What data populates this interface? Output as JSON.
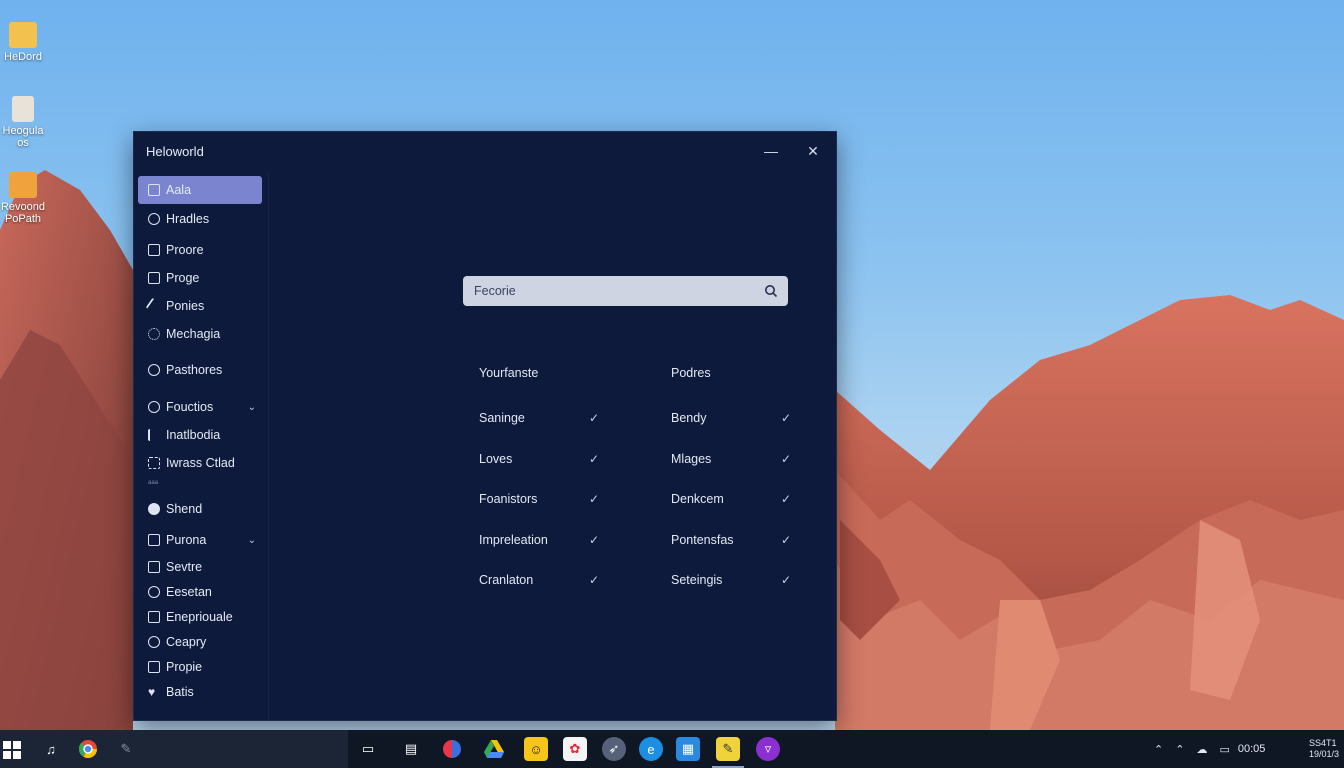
{
  "desktop": {
    "icons": [
      {
        "label": "HeDord",
        "icon": "folder-icon",
        "color": "#f2c14e"
      },
      {
        "label": "Heogula",
        "sublabel": "os",
        "icon": "document-icon",
        "color": "#e8e2d8"
      },
      {
        "label": "Revoond",
        "sublabel": "PoPath",
        "icon": "app-icon",
        "color": "#f0a23c"
      }
    ]
  },
  "window": {
    "title": "Heloworld",
    "minimize_glyph": "—",
    "close_glyph": "✕"
  },
  "sidebar": {
    "items": [
      {
        "label": "Aala",
        "icon": "document-icon",
        "active": true
      },
      {
        "label": "Hradles",
        "icon": "person-icon"
      },
      {
        "label": "Proore",
        "icon": "book-icon"
      },
      {
        "label": "Proge",
        "icon": "page-icon"
      },
      {
        "label": "Ponies",
        "icon": "pen-icon"
      },
      {
        "label": "Mechagia",
        "icon": "gear-icon"
      },
      {
        "label": "Pasthores",
        "icon": "user-search-icon"
      },
      {
        "label": "Fouctios",
        "icon": "key-icon",
        "expandable": true
      },
      {
        "label": "Inatlbodia",
        "icon": "lines-icon"
      },
      {
        "label": "Iwrass Ctlad",
        "icon": "grid-icon",
        "sublabel": "ᵃᵃᵃ"
      },
      {
        "label": "Shend",
        "icon": "circle-icon"
      },
      {
        "label": "Purona",
        "icon": "card-icon",
        "expandable": true
      },
      {
        "label": "Sevtre",
        "icon": "list-icon"
      },
      {
        "label": "Eesetan",
        "icon": "ring-icon"
      },
      {
        "label": "Enepriouale",
        "icon": "box-icon"
      },
      {
        "label": "Ceapry",
        "icon": "globe-icon"
      },
      {
        "label": "Propie",
        "icon": "square-icon"
      },
      {
        "label": "Batis",
        "icon": "heart-icon"
      }
    ]
  },
  "search": {
    "placeholder": "Fecorie"
  },
  "options": {
    "left_heading": "Yourfanste",
    "right_heading": "Podres",
    "left": [
      "Saninge",
      "Loves",
      "Foanistors",
      "Impreleation",
      "Cranlaton"
    ],
    "right": [
      "Bendy",
      "Mlages",
      "Denkcem",
      "Pontensfas",
      "Seteingis"
    ],
    "check_glyph": "✓"
  },
  "taskbar": {
    "apps": [
      "music-icon",
      "chrome-icon",
      "pen-icon",
      "folder-icon",
      "notes-icon",
      "app-red-blue-icon",
      "drive-icon",
      "chat-icon",
      "photos-icon",
      "compass-icon",
      "edge-icon",
      "store-icon",
      "sticky-icon",
      "purple-app-icon"
    ],
    "time": "00:05",
    "tray_right_top": "SS4T1",
    "tray_right_bottom": "19/01/3"
  },
  "colors": {
    "window_bg": "#0e1a3c",
    "active_item": "#7b84cf",
    "search_bg": "#cfd4e2",
    "taskbar_bg": "#0f1725",
    "mountain": "#b8574b"
  }
}
